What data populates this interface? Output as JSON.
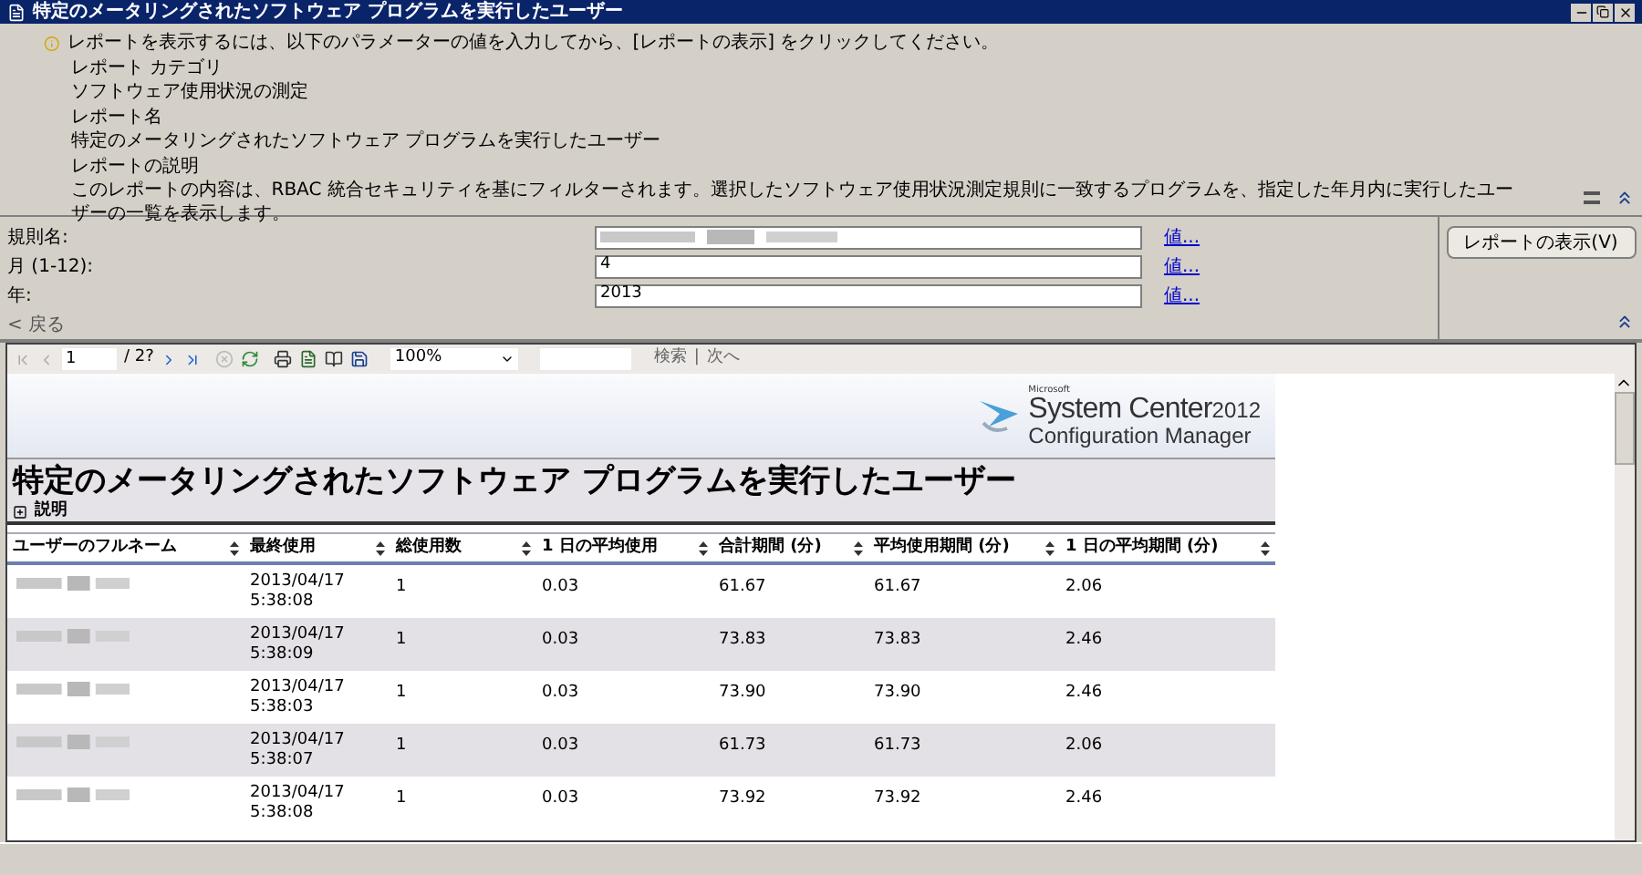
{
  "window": {
    "title": "特定のメータリングされたソフトウェア プログラムを実行したユーザー"
  },
  "info": {
    "instruction": "レポートを表示するには、以下のパラメーターの値を入力してから、[レポートの表示] をクリックしてください。",
    "items": [
      {
        "label": "レポート カテゴリ",
        "value": "ソフトウェア使用状況の測定"
      },
      {
        "label": "レポート名",
        "value": "特定のメータリングされたソフトウェア プログラムを実行したユーザー"
      },
      {
        "label": "レポートの説明",
        "value": "このレポートの内容は、RBAC 統合セキュリティを基にフィルターされます。選択したソフトウェア使用状況測定規則に一致するプログラムを、指定した年月内に実行したユーザーの一覧を表示します。"
      }
    ]
  },
  "parameters": [
    {
      "label": "規則名:",
      "value_blurred": true,
      "link": "値..."
    },
    {
      "label": "月 (1-12):",
      "value": "4",
      "value_blurred": false,
      "link": "値..."
    },
    {
      "label": "年:",
      "value": "2013",
      "value_blurred": false,
      "link": "値..."
    }
  ],
  "back_link": "< 戻る",
  "view_report_button": "レポートの表示(V)",
  "toolbar": {
    "page": "1",
    "page_count": "/ 2?",
    "zoom": "100%",
    "find": "検索",
    "separator": "|",
    "next": "次へ"
  },
  "logo": {
    "company": "Microsoft",
    "product": "System Center",
    "year": "2012",
    "edition": "Configuration Manager"
  },
  "report": {
    "title": "特定のメータリングされたソフトウェア プログラムを実行したユーザー",
    "description_toggle": "説明",
    "columns": [
      "ユーザーのフルネーム",
      "最終使用",
      "総使用数",
      "1 日の平均使用",
      "合計期間 (分)",
      "平均使用期間 (分)",
      "1 日の平均期間 (分)"
    ],
    "rows": [
      {
        "name_blurred": true,
        "cells": [
          "",
          "2013/04/17 5:38:08",
          "1",
          "0.03",
          "61.67",
          "61.67",
          "2.06"
        ]
      },
      {
        "name_blurred": true,
        "cells": [
          "",
          "2013/04/17 5:38:09",
          "1",
          "0.03",
          "73.83",
          "73.83",
          "2.46"
        ]
      },
      {
        "name_blurred": true,
        "cells": [
          "",
          "2013/04/17 5:38:03",
          "1",
          "0.03",
          "73.90",
          "73.90",
          "2.46"
        ]
      },
      {
        "name_blurred": true,
        "cells": [
          "",
          "2013/04/17 5:38:07",
          "1",
          "0.03",
          "61.73",
          "61.73",
          "2.06"
        ]
      },
      {
        "name_blurred": true,
        "cells": [
          "",
          "2013/04/17 5:38:08",
          "1",
          "0.03",
          "73.92",
          "73.92",
          "2.46"
        ]
      }
    ]
  }
}
